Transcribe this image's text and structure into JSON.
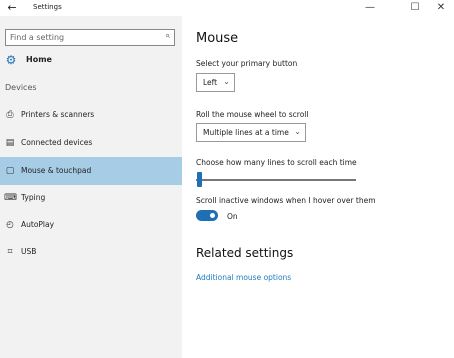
{
  "window": {
    "title": "Settings",
    "back": "←",
    "minimize": "—",
    "maximize": "☐",
    "close": "✕"
  },
  "sidebar": {
    "search_placeholder": "Find a setting",
    "search_icon": "⌕",
    "home_icon": "⚙",
    "home_label": "Home",
    "section_label": "Devices",
    "items": [
      {
        "label": "Printers & scanners",
        "icon": "printer-icon",
        "glyph": "⎙"
      },
      {
        "label": "Connected devices",
        "icon": "devices-icon",
        "glyph": "▤"
      },
      {
        "label": "Mouse & touchpad",
        "icon": "mouse-icon",
        "glyph": "▢",
        "selected": true
      },
      {
        "label": "Typing",
        "icon": "keyboard-icon",
        "glyph": "⌨"
      },
      {
        "label": "AutoPlay",
        "icon": "autoplay-icon",
        "glyph": "◴"
      },
      {
        "label": "USB",
        "icon": "usb-icon",
        "glyph": "⌗"
      }
    ]
  },
  "main": {
    "title": "Mouse",
    "primary_button": {
      "label": "Select your primary button",
      "value": "Left"
    },
    "scroll_wheel": {
      "label": "Roll the mouse wheel to scroll",
      "value": "Multiple lines at a time"
    },
    "lines_to_scroll": {
      "label": "Choose how many lines to scroll each time",
      "value": 3
    },
    "scroll_inactive": {
      "label": "Scroll inactive windows when I hover over them",
      "state": "On"
    },
    "related": {
      "title": "Related settings",
      "link": "Additional mouse options"
    },
    "chevron": "⌄"
  },
  "colors": {
    "accent": "#1e6fb3",
    "selected_bg": "#a7cde6",
    "link": "#1e7bbf",
    "sidebar_bg": "#f2f2f2"
  }
}
